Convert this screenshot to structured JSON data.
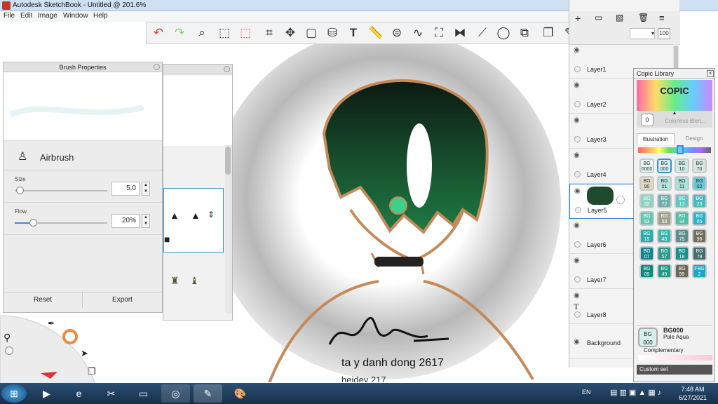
{
  "window": {
    "title": "Autodesk SketchBook - Untitled @ 201.6%"
  },
  "menu": [
    "File",
    "Edit",
    "Image",
    "Window",
    "Help"
  ],
  "toolbar": {
    "icons": [
      "undo-icon",
      "redo-icon",
      "zoom-icon",
      "select-icon",
      "lasso-icon",
      "crop-icon",
      "transform-icon",
      "distort-icon",
      "bucket-icon",
      "text-icon",
      "ruler-icon",
      "ellipse-guide-icon",
      "curve-icon",
      "perspective-icon",
      "symmetry-icon",
      "stroke-icon",
      "ellipse-icon",
      "shapes-icon",
      "copy-icon",
      "brush-icon",
      "color-wheel-icon",
      "layout-icon"
    ],
    "zoom_value": "100"
  },
  "brush_panel": {
    "title": "Brush Properties",
    "brush_name": "Airbrush",
    "size_label": "Size",
    "size_value": "5.0",
    "size_level": 0.05,
    "flow_label": "Flow",
    "flow_value": "20%",
    "flow_level": 0.2,
    "reset_label": "Reset",
    "export_label": "Export"
  },
  "canvas": {
    "signature_text": "ta y danh dong 2617",
    "overflow_text": "heidey 217"
  },
  "layers": [
    {
      "name": "Layer1",
      "visible": true
    },
    {
      "name": "Layer2",
      "visible": true
    },
    {
      "name": "Layer3",
      "visible": true
    },
    {
      "name": "Layer4",
      "visible": true
    },
    {
      "name": "Layer5",
      "visible": true,
      "selected": true
    },
    {
      "name": "Layer6",
      "visible": true
    },
    {
      "name": "Layer7",
      "visible": true
    },
    {
      "name": "Layer8",
      "visible": true,
      "text_layer": true
    },
    {
      "name": "Background",
      "visible": true
    }
  ],
  "copic": {
    "title": "Copic Library",
    "logo": "COPIC",
    "colorless_label": "Colorless Blen...",
    "colorless_code": "0",
    "tab_illustration": "Illustration",
    "tab_design": "Design",
    "swatches": [
      {
        "code": "BG 0000",
        "color": "#e4f4f1"
      },
      {
        "code": "BG 000",
        "color": "#d6efec"
      },
      {
        "code": "BG 10",
        "color": "#cdebe4"
      },
      {
        "code": "BG 70",
        "color": "#d8e6e2"
      },
      {
        "code": "BG 90",
        "color": "#dcd8c4"
      },
      {
        "code": "BG 01",
        "color": "#b4e4e2"
      },
      {
        "code": "BG 11",
        "color": "#a8e0d8"
      },
      {
        "code": "BG 02",
        "color": "#67c8d8"
      },
      {
        "code": "BG 32",
        "color": "#8fd3c4"
      },
      {
        "code": "BG 72",
        "color": "#72aeae"
      },
      {
        "code": "BG 13",
        "color": "#5fc9c0"
      },
      {
        "code": "BG 23",
        "color": "#44bcc0"
      },
      {
        "code": "BG 53",
        "color": "#67c7b4"
      },
      {
        "code": "BG 93",
        "color": "#a0a08a"
      },
      {
        "code": "BG 34",
        "color": "#4fbfa8"
      },
      {
        "code": "BG 05",
        "color": "#2ab3c8"
      },
      {
        "code": "BG 15",
        "color": "#29aeaa"
      },
      {
        "code": "BG 45",
        "color": "#3bb6ac"
      },
      {
        "code": "BG 75",
        "color": "#5a8f8c"
      },
      {
        "code": "BG 96",
        "color": "#6f6f5c"
      },
      {
        "code": "BG 07",
        "color": "#11868f"
      },
      {
        "code": "BG 57",
        "color": "#2a9a8f"
      },
      {
        "code": "BG 18",
        "color": "#198f8a"
      },
      {
        "code": "BG 78",
        "color": "#3f6e6b"
      },
      {
        "code": "BG 09",
        "color": "#0c8a82"
      },
      {
        "code": "BG 49",
        "color": "#1d9a88"
      },
      {
        "code": "BG 99",
        "color": "#6b6a55"
      },
      {
        "code": "FBG 2",
        "color": "#1ea6c8"
      }
    ],
    "selected_code": "BG000",
    "selected_name": "Pale Aqua",
    "selected_swatch": "BG 000",
    "complementary_label": "Complementary",
    "custom_set_label": "Custom set"
  },
  "taskbar": {
    "lang": "EN",
    "time": "7:48 AM",
    "date": "6/27/2021"
  },
  "colors": {
    "accent": "#3a8fd6",
    "hair": "#1f4a2e",
    "outline": "#c58a5a",
    "titlebar": "#cfe0f2"
  }
}
